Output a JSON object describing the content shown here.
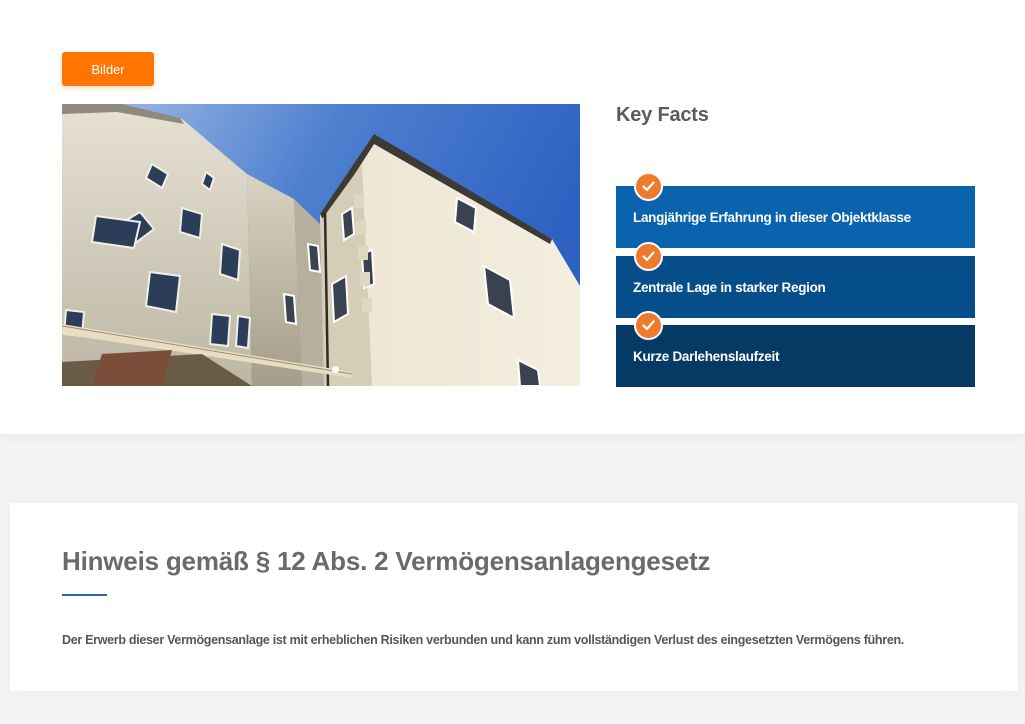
{
  "gallery": {
    "button_label": "Bilder",
    "photo_description": "Altbau-Mehrfamilienhaus Innenhof, blauer Himmel",
    "slide_count": 2,
    "active_slide": 1
  },
  "key_facts": {
    "title": "Key Facts",
    "items": [
      {
        "label": "Langjährige Erfahrung in dieser Objektklasse",
        "color": "#0a63ad"
      },
      {
        "label": "Zentrale Lage in starker Region",
        "color": "#064e8a"
      },
      {
        "label": "Kurze Darlehenslaufzeit",
        "color": "#043a63"
      }
    ],
    "check_icon": "check-circle-icon",
    "check_color": "#ef7a2e"
  },
  "notice": {
    "title": "Hinweis gemäß § 12 Abs. 2 Vermögensanlagengesetz",
    "text": "Der Erwerb dieser Vermögensanlage ist mit erheblichen Risiken verbunden und kann zum vollständigen Verlust des eingesetzten Vermögens führen."
  },
  "colors": {
    "accent_orange": "#ff7500",
    "rule_blue": "#2b66b0"
  }
}
